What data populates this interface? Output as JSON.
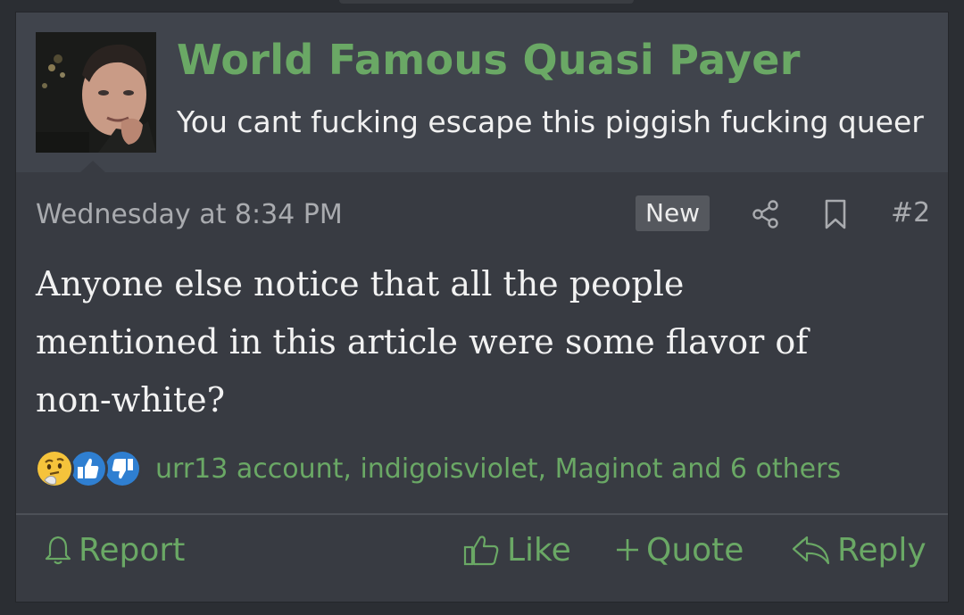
{
  "post": {
    "author": {
      "name": "World Famous Quasi Payer",
      "title": "You cant fucking escape this piggish fucking queer"
    },
    "date": "Wednesday at 8:34 PM",
    "badge": "New",
    "number": "#2",
    "body_lines": [
      "Anyone else notice that all the people",
      "mentioned in this article were some flavor of",
      "non-white?"
    ],
    "reactions": {
      "icons": [
        "thinking-face-icon",
        "thumbs-up-icon",
        "thumbs-down-icon"
      ],
      "users_text": "urr13 account, indigoisviolet, Maginot and 6 others"
    },
    "actions": {
      "report": "Report",
      "like": "Like",
      "quote": "Quote",
      "reply": "Reply"
    }
  },
  "colors": {
    "accent_green": "#6aa865",
    "post_bg": "#383b42",
    "header_bg": "#40444c",
    "page_bg": "#2b2e33",
    "muted_text": "#a9abaf",
    "reaction_blue": "#2f7fd1"
  }
}
